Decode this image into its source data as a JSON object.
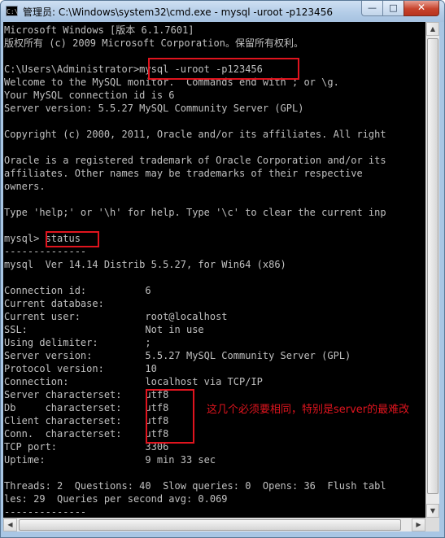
{
  "window": {
    "title": "管理员: C:\\Windows\\system32\\cmd.exe - mysql  -uroot -p123456",
    "icon_name": "cmd-icon",
    "icon_text": "C:\\",
    "buttons": {
      "minimize": "—",
      "maximize": "□",
      "close": "✕"
    }
  },
  "console": {
    "text_color": "#c0c0c0",
    "background": "#000000",
    "lines": [
      "Microsoft Windows [版本 6.1.7601]",
      "版权所有 (c) 2009 Microsoft Corporation。保留所有权利。",
      "",
      "C:\\Users\\Administrator>mysql -uroot -p123456",
      "Welcome to the MySQL monitor.  Commands end with ; or \\g.",
      "Your MySQL connection id is 6",
      "Server version: 5.5.27 MySQL Community Server (GPL)",
      "",
      "Copyright (c) 2000, 2011, Oracle and/or its affiliates. All right",
      "",
      "Oracle is a registered trademark of Oracle Corporation and/or its",
      "affiliates. Other names may be trademarks of their respective",
      "owners.",
      "",
      "Type 'help;' or '\\h' for help. Type '\\c' to clear the current inp",
      "",
      "mysql> status",
      "--------------",
      "mysql  Ver 14.14 Distrib 5.5.27, for Win64 (x86)",
      "",
      "Connection id:          6",
      "Current database:",
      "Current user:           root@localhost",
      "SSL:                    Not in use",
      "Using delimiter:        ;",
      "Server version:         5.5.27 MySQL Community Server (GPL)",
      "Protocol version:       10",
      "Connection:             localhost via TCP/IP",
      "Server characterset:    utf8",
      "Db     characterset:    utf8",
      "Client characterset:    utf8",
      "Conn.  characterset:    utf8",
      "TCP port:               3306",
      "Uptime:                 9 min 33 sec",
      "",
      "Threads: 2  Questions: 40  Slow queries: 0  Opens: 36  Flush tabl",
      "les: 29  Queries per second avg: 0.069",
      "--------------"
    ]
  },
  "annotation": {
    "color": "#e0141e",
    "note": "这几个必须要相同，特别是server的最难改"
  },
  "scrollbars": {
    "up_arrow": "▲",
    "down_arrow": "▼",
    "left_arrow": "◀",
    "right_arrow": "▶"
  }
}
